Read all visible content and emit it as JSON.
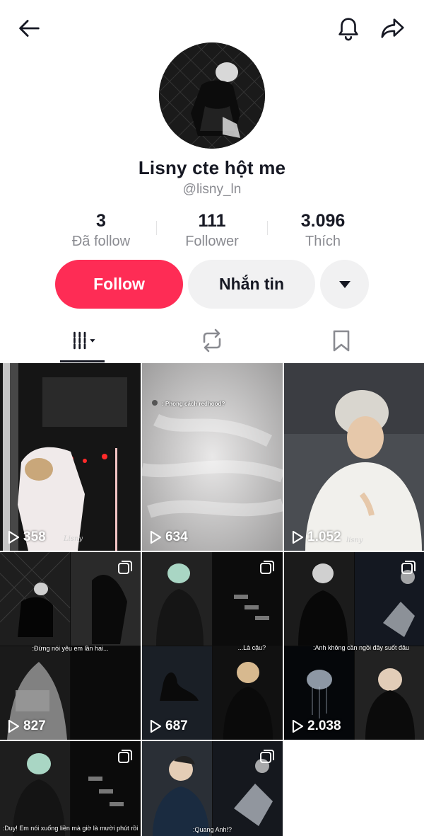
{
  "profile": {
    "display_name": "Lisny cte hột me",
    "handle": "@lisny_ln"
  },
  "stats": {
    "following": {
      "value": "3",
      "label": "Đã follow"
    },
    "followers": {
      "value": "111",
      "label": "Follower"
    },
    "likes": {
      "value": "3.096",
      "label": "Thích"
    }
  },
  "actions": {
    "follow_label": "Follow",
    "message_label": "Nhắn tin"
  },
  "icons": {
    "back": "arrow-left-icon",
    "notifications": "bell-icon",
    "share": "share-arrow-icon",
    "more": "caret-down-icon",
    "tab_videos": "grid-lines-icon",
    "tab_reposts": "repost-icon",
    "tab_saved": "bookmark-icon"
  },
  "colors": {
    "accent": "#fe2c55",
    "secondary_button": "#f1f1f2",
    "muted_text": "#8a8b91"
  },
  "videos": [
    {
      "views": "358",
      "watermark": "Lisny"
    },
    {
      "views": "634",
      "overlay_text": ": Phong cách redhood?"
    },
    {
      "views": "1.052",
      "watermark": "lisny"
    },
    {
      "views": "827",
      "caption": ":Đừng nói yêu em lần hai..."
    },
    {
      "views": "687",
      "caption": "...Là cậu?"
    },
    {
      "views": "2.038",
      "caption": ":Anh không cần ngồi đây suốt đâu"
    },
    {
      "views": "",
      "caption": ":Duy! Em nói xuống liền mà giờ là mười phút rồi"
    },
    {
      "views": "",
      "caption": ":Quang Anh!?"
    }
  ]
}
